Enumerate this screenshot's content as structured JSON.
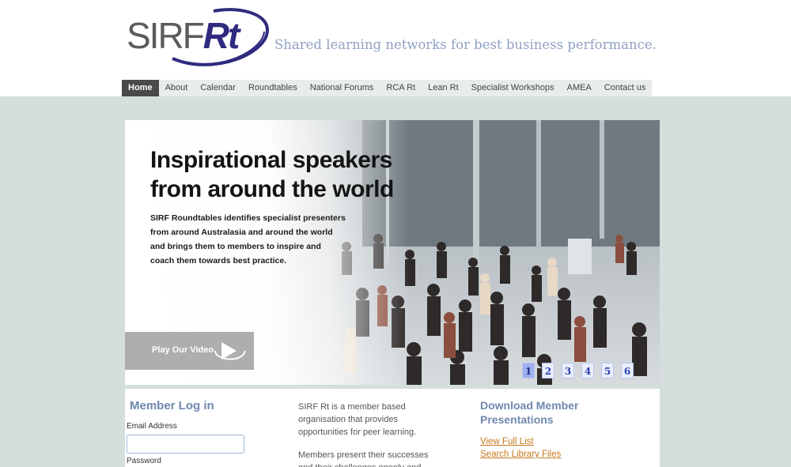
{
  "brand": {
    "logo_text_a": "SIRF",
    "logo_text_b": "Rt",
    "tagline": "Shared learning networks for best business performance.",
    "colors": {
      "logo_blue": "#2f2b7e",
      "tagline": "#8fa2c4",
      "page_bg": "#d4dedd"
    }
  },
  "nav": {
    "items": [
      {
        "label": "Home",
        "active": true
      },
      {
        "label": "About"
      },
      {
        "label": "Calendar"
      },
      {
        "label": "Roundtables"
      },
      {
        "label": "National Forums"
      },
      {
        "label": "RCA Rt"
      },
      {
        "label": "Lean Rt"
      },
      {
        "label": "Specialist Workshops"
      },
      {
        "label": "AMEA"
      },
      {
        "label": "Contact us"
      }
    ]
  },
  "hero": {
    "title_line1": "Inspirational speakers",
    "title_line2": "from around the world",
    "desc_line1": "SIRF Roundtables identifies specialist presenters",
    "desc_line2": "from around Australasia and around the world",
    "desc_line3": "and brings them to members to inspire and",
    "desc_line4": "coach them towards best practice.",
    "video_button": "Play Our Video",
    "play_icon": "play-circle-icon",
    "pager": [
      "1",
      "2",
      "3",
      "4",
      "5",
      "6"
    ],
    "active_slide": "1"
  },
  "login": {
    "title": "Member Log in",
    "email_label": "Email Address",
    "email_value": "",
    "password_label": "Password"
  },
  "about": {
    "para1": "SIRF Rt is a member based organisation that provides opportunities for peer learning.",
    "para2": "Members present their successes and their challenges openly and"
  },
  "downloads": {
    "title": "Download Member Presentations",
    "link1": "View Full List",
    "link2": "Search Library Files"
  }
}
